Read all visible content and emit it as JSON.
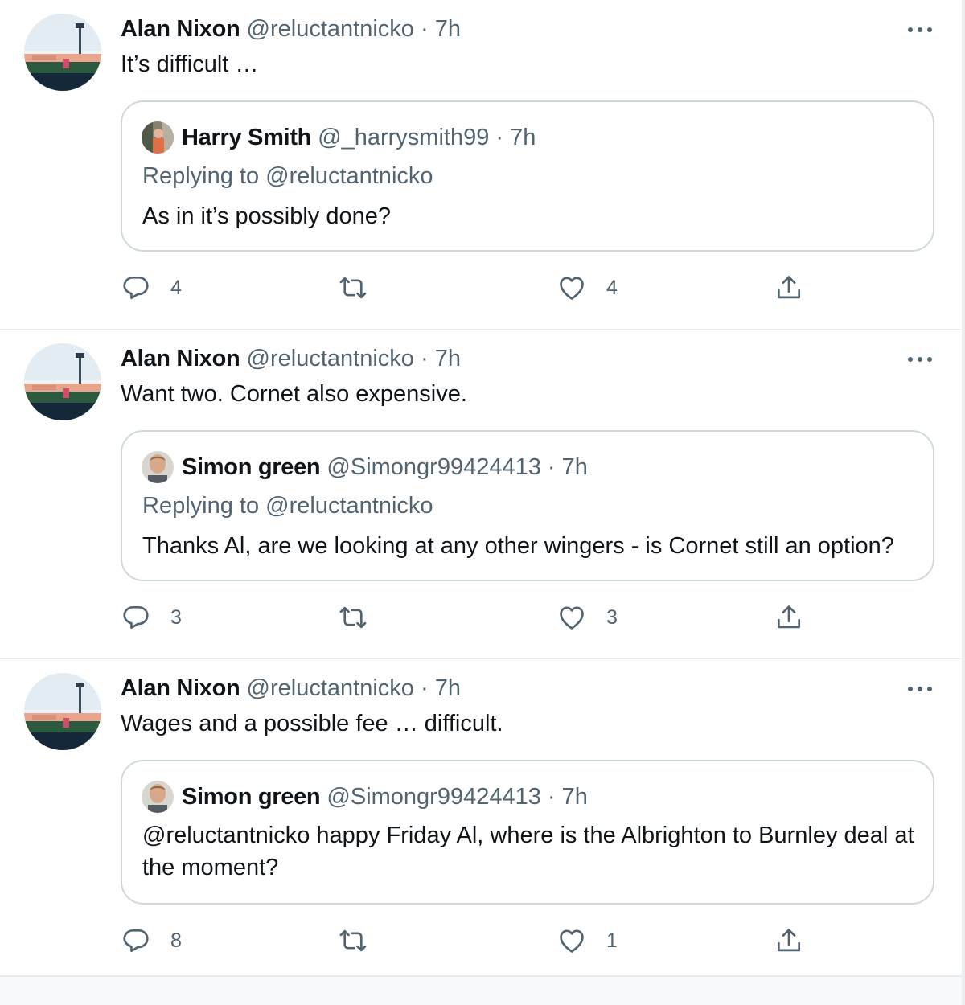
{
  "tweets": [
    {
      "name": "Alan Nixon",
      "handle": "@reluctantnicko",
      "sep": "·",
      "time": "7h",
      "text": "It’s difficult …",
      "quote": {
        "name": "Harry Smith",
        "handle": "@_harrysmith99",
        "sep": "·",
        "time": "7h",
        "replying": "Replying to @reluctantnicko",
        "text": "As in it’s possibly done?"
      },
      "replies": "4",
      "retweets": "",
      "likes": "4"
    },
    {
      "name": "Alan Nixon",
      "handle": "@reluctantnicko",
      "sep": "·",
      "time": "7h",
      "text": "Want two. Cornet also expensive.",
      "quote": {
        "name": "Simon green",
        "handle": "@Simongr99424413",
        "sep": "·",
        "time": "7h",
        "replying": "Replying to @reluctantnicko",
        "text": "Thanks Al, are we looking at any other wingers - is Cornet still an option?"
      },
      "replies": "3",
      "retweets": "",
      "likes": "3"
    },
    {
      "name": "Alan Nixon",
      "handle": "@reluctantnicko",
      "sep": "·",
      "time": "7h",
      "text": "Wages and a possible fee … difficult.",
      "quote": {
        "name": "Simon green",
        "handle": "@Simongr99424413",
        "sep": "·",
        "time": "7h",
        "text": "@reluctantnicko happy Friday Al, where is the Albrighton to Burnley deal at the moment?"
      },
      "replies": "8",
      "retweets": "",
      "likes": "1"
    }
  ],
  "icons": {
    "reply": "reply-icon",
    "retweet": "retweet-icon",
    "like": "heart-icon",
    "share": "share-icon",
    "more": "more-icon"
  },
  "colors": {
    "text": "#0f1419",
    "secondary": "#536471",
    "border": "#cfd9de",
    "divider": "#e6ecf0"
  }
}
